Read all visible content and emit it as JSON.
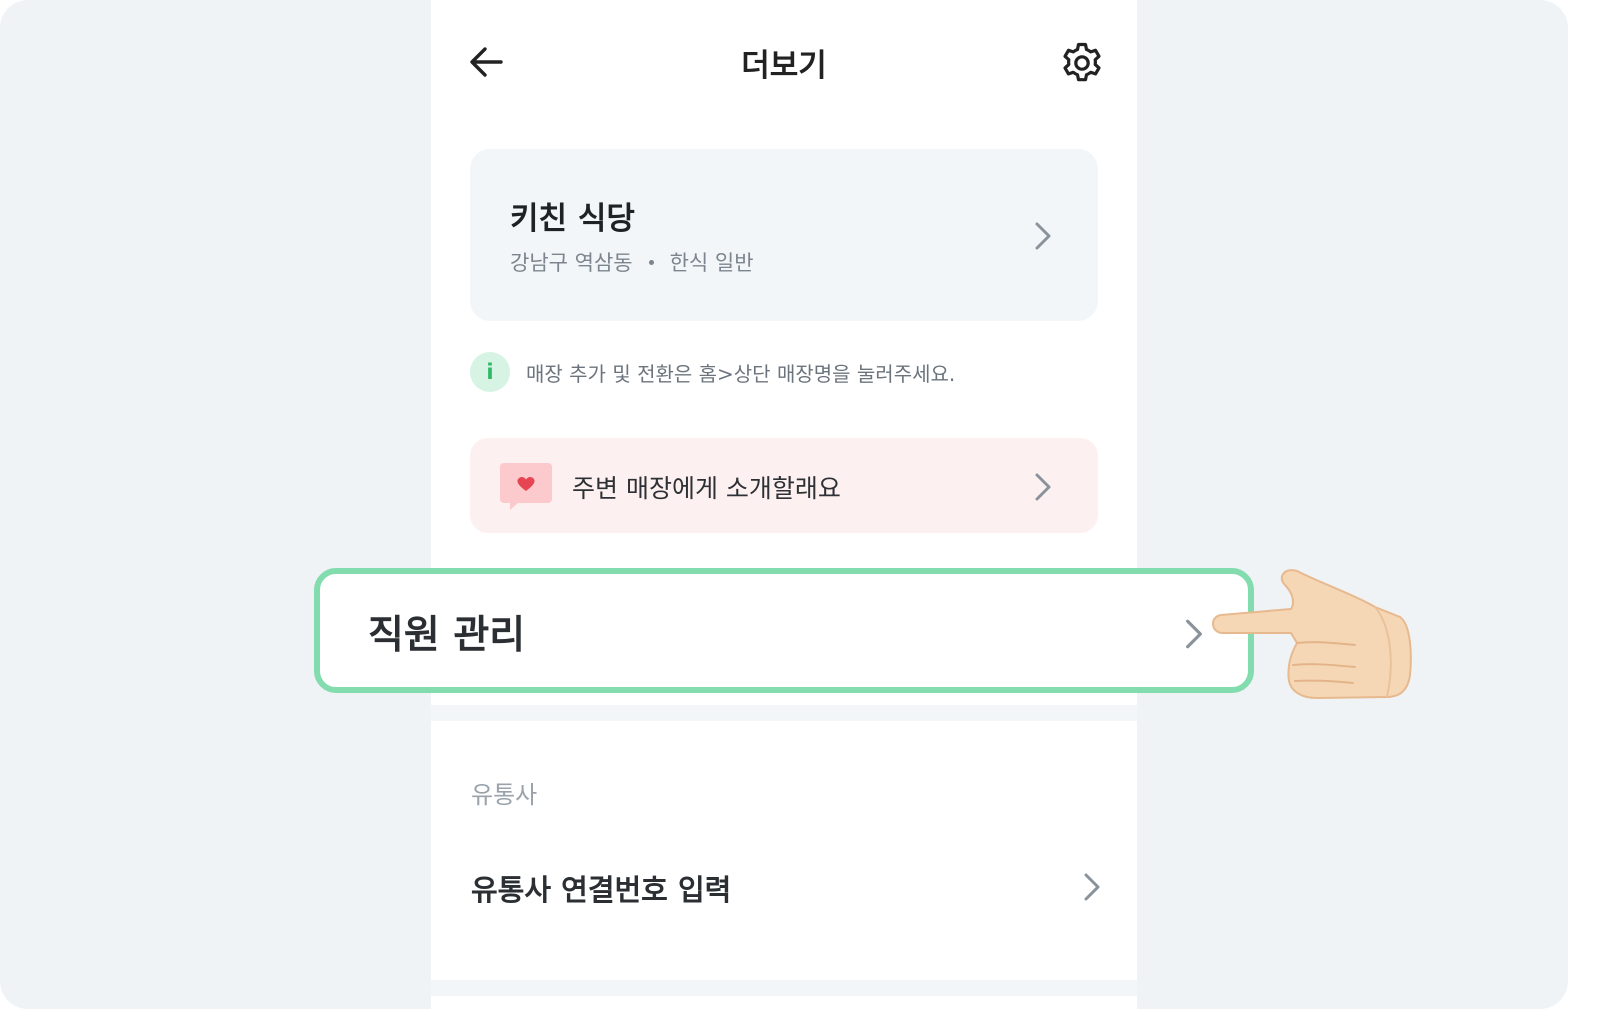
{
  "header": {
    "title": "더보기",
    "back_icon": "arrow-left-icon",
    "settings_icon": "gear-icon"
  },
  "store": {
    "name": "키친 식당",
    "location": "강남구 역삼동",
    "category": "한식 일반"
  },
  "info": {
    "icon_label": "i",
    "text": "매장 추가 및 전환은 홈>상단 매장명을 눌러주세요."
  },
  "referral": {
    "label": "주변 매장에게 소개할래요",
    "icon": "heart-chat-icon"
  },
  "staff": {
    "label": "직원 관리"
  },
  "distributor": {
    "section_title": "유통사",
    "connect_label": "유통사 연결번호 입력"
  },
  "colors": {
    "background": "#eff3f6",
    "highlight_border": "#82dcae",
    "info_green": "#2fb868",
    "referral_bg": "#fdf0f1",
    "heart_red": "#e64553"
  }
}
